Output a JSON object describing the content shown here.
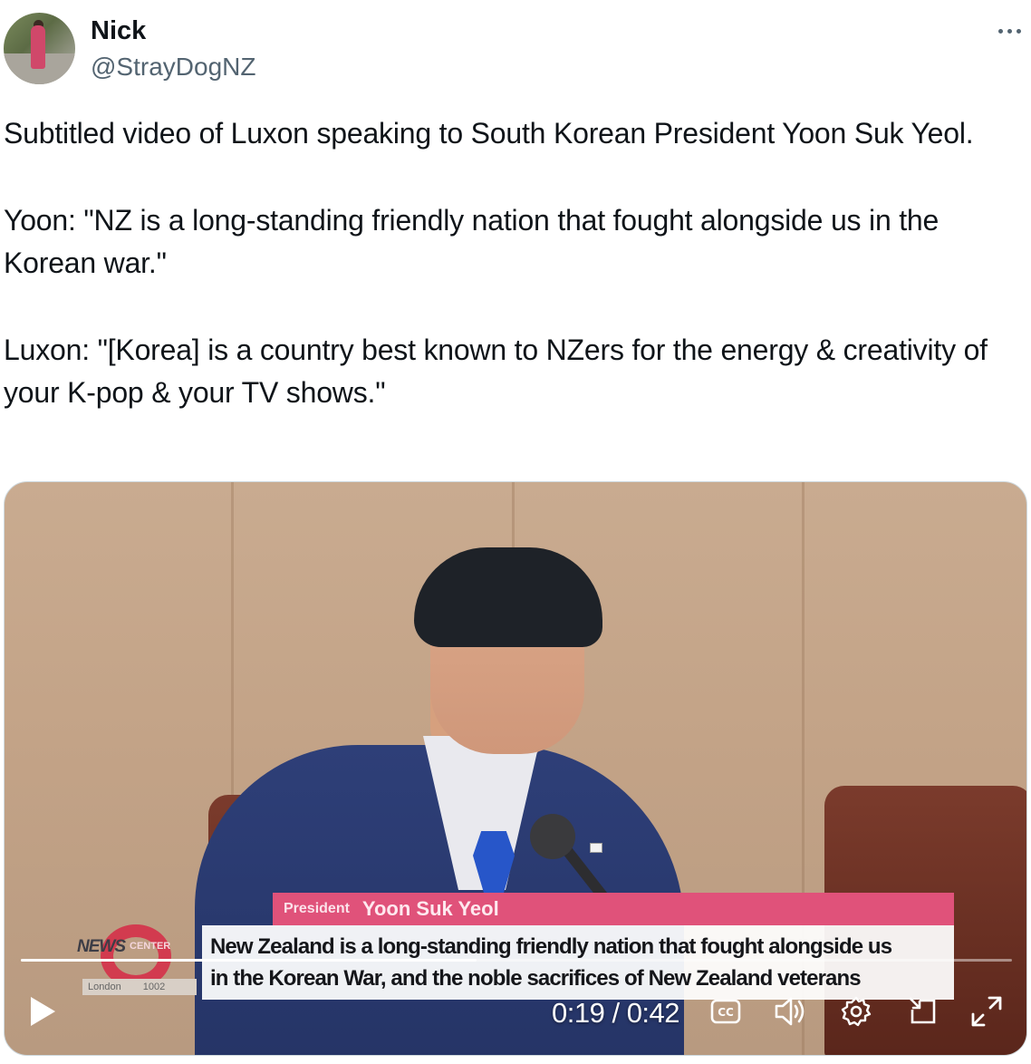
{
  "author": {
    "display_name": "Nick",
    "handle": "@StrayDogNZ"
  },
  "tweet": {
    "paragraphs": [
      "Subtitled video of Luxon speaking to South Korean President Yoon Suk Yeol.",
      "Yoon: \"NZ is a long-standing friendly nation that fought alongside us in the Korean war.\"",
      "Luxon: \"[Korea] is a country best known to NZers for the energy & creativity of your K-pop & your TV shows.\""
    ]
  },
  "video": {
    "caption": {
      "role": "President",
      "name": "Yoon Suk Yeol",
      "line1": "New Zealand is a long-standing friendly nation that fought alongside us",
      "line2": "in the Korean War, and the noble sacrifices of New Zealand veterans"
    },
    "channel_logo": {
      "word": "NEWS",
      "sub": "CENTER",
      "city": "London",
      "number": "1002"
    },
    "player": {
      "current_time": "0:19",
      "separator": " / ",
      "duration": "0:42",
      "progress_fraction": 0.46
    },
    "icons": {
      "play": "play-icon",
      "captions": "closed-captions-icon",
      "volume": "volume-icon",
      "settings": "gear-icon",
      "pip": "picture-in-picture-icon",
      "fullscreen": "fullscreen-icon",
      "more": "more-dots-icon"
    }
  }
}
